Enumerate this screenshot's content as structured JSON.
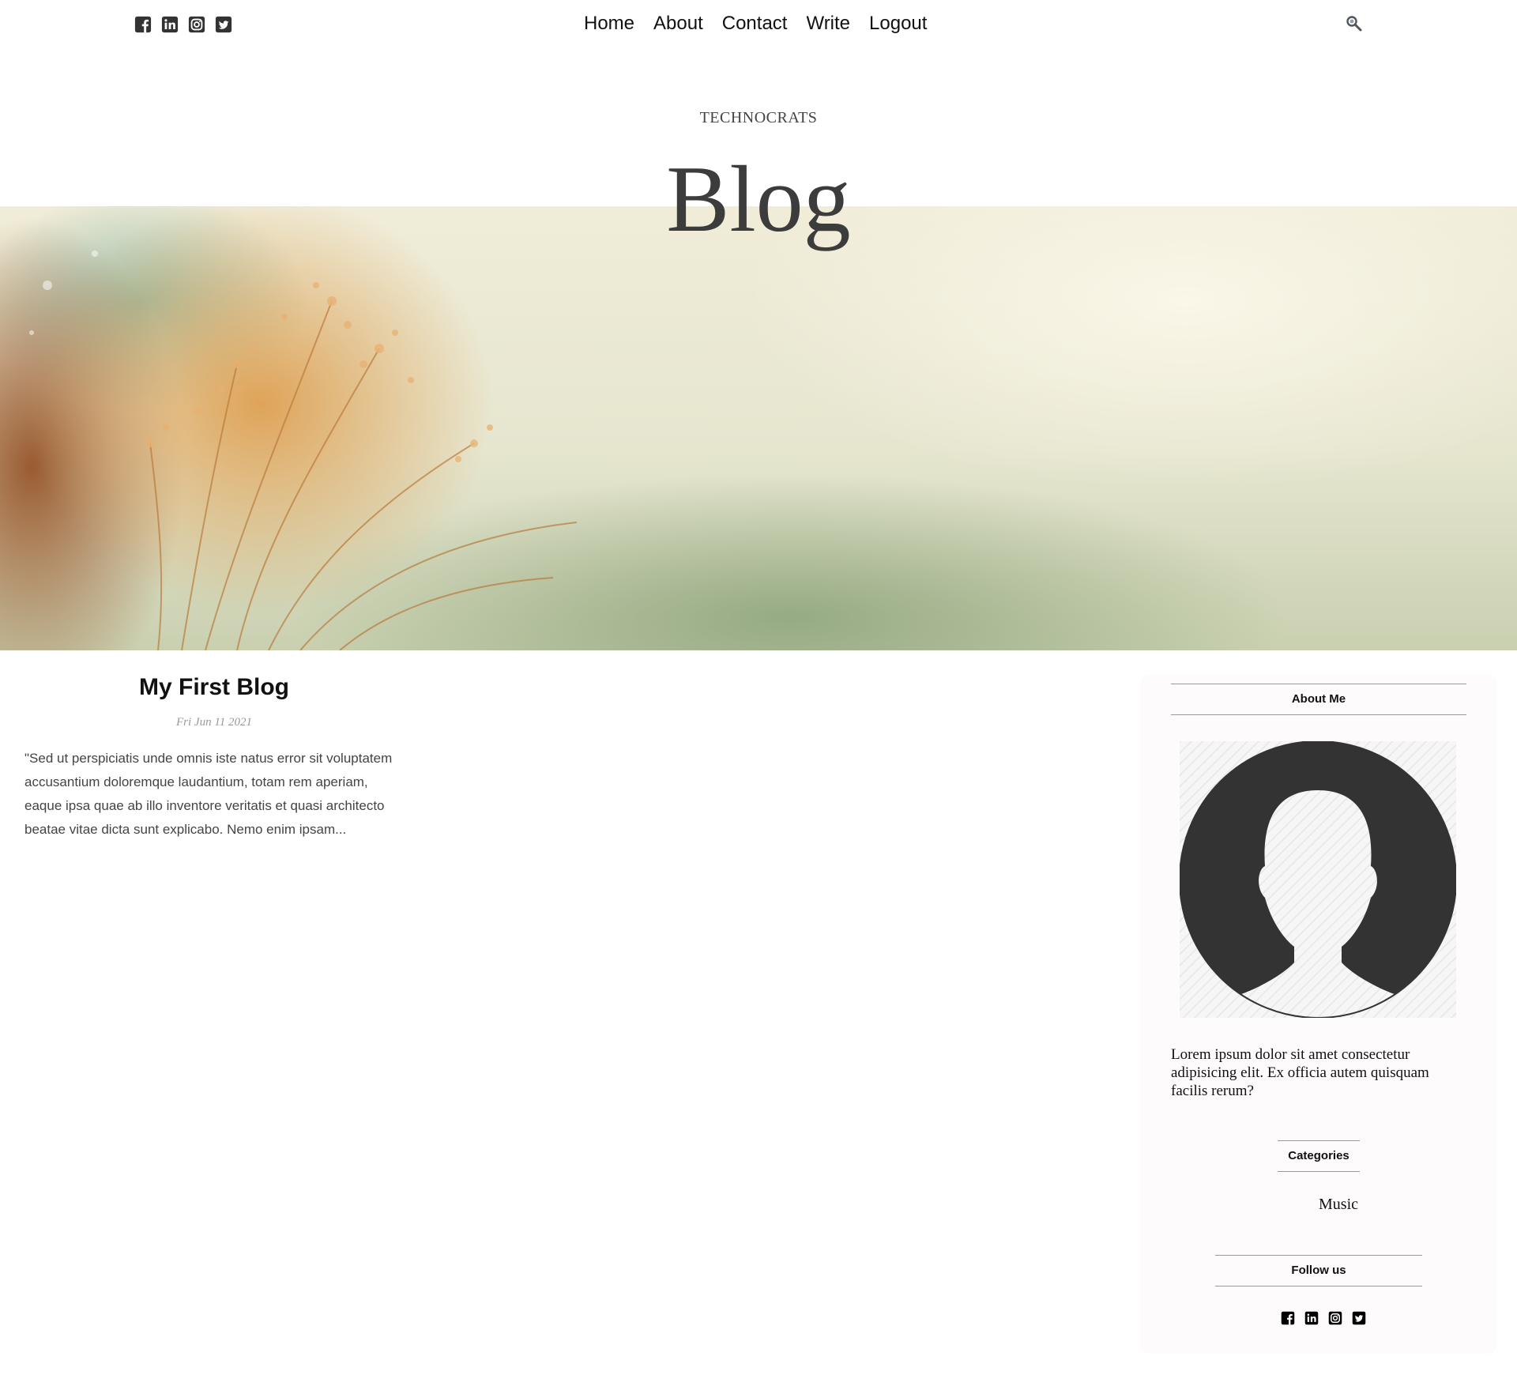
{
  "nav": {
    "items": [
      "Home",
      "About",
      "Contact",
      "Write",
      "Logout"
    ]
  },
  "social_icons": [
    "facebook-square-icon",
    "linkedin-icon",
    "instagram-icon",
    "twitter-icon"
  ],
  "header": {
    "subtitle": "TECHNOCRATS",
    "title": "Blog"
  },
  "post": {
    "title": "My First Blog",
    "date": "Fri Jun 11 2021",
    "excerpt": "\"Sed ut perspiciatis unde omnis iste natus error sit voluptatem accusantium doloremque laudantium, totam rem aperiam, eaque ipsa quae ab illo inventore veritatis et quasi architecto beatae vitae dicta sunt explicabo. Nemo enim ipsam..."
  },
  "sidebar": {
    "about_title": "About Me",
    "about_text": "Lorem ipsum dolor sit amet consectetur adipisicing elit. Ex officia autem quisquam facilis rerum?",
    "categories_title": "Categories",
    "categories": [
      "Music"
    ],
    "follow_title": "Follow us"
  },
  "colors": {
    "text": "#111111",
    "muted": "#999999",
    "title": "#3c3c3c",
    "sidebar_bg": "#fdfbfb",
    "avatar": "#333333"
  }
}
